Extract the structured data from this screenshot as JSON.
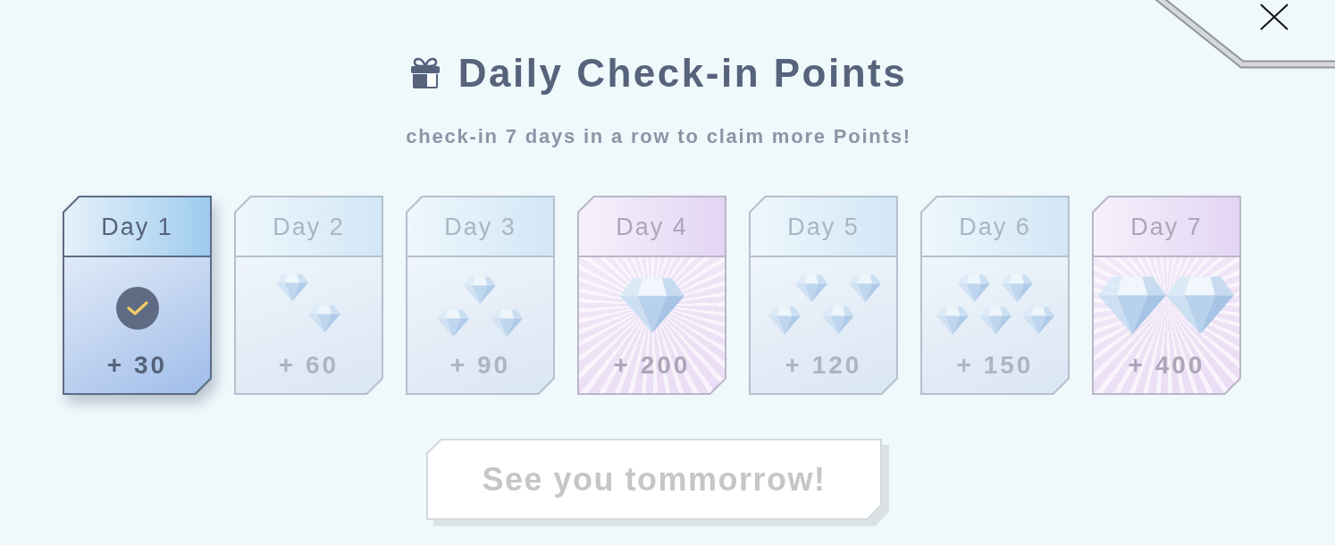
{
  "dialog": {
    "title": "Daily Check-in Points",
    "subtitle": "check-in 7 days in a row to claim more Points!"
  },
  "days": [
    {
      "label": "Day 1",
      "points": "+ 30",
      "kind": "gems1",
      "checked": true
    },
    {
      "label": "Day 2",
      "points": "+ 60",
      "kind": "gems2",
      "checked": false
    },
    {
      "label": "Day 3",
      "points": "+ 90",
      "kind": "gems3",
      "checked": false
    },
    {
      "label": "Day 4",
      "points": "+ 200",
      "kind": "jewel",
      "checked": false
    },
    {
      "label": "Day 5",
      "points": "+ 120",
      "kind": "gems4",
      "checked": false
    },
    {
      "label": "Day 6",
      "points": "+ 150",
      "kind": "gems5",
      "checked": false
    },
    {
      "label": "Day 7",
      "points": "+ 400",
      "kind": "jewels",
      "checked": false
    }
  ],
  "button": {
    "label": "See you tommorrow!",
    "disabled": true
  }
}
